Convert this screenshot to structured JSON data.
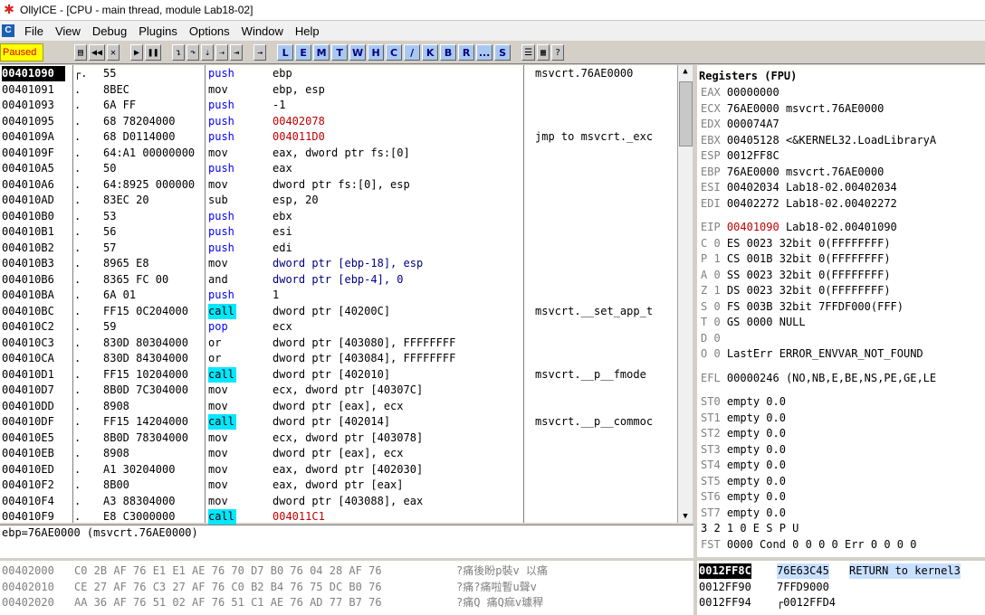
{
  "window": {
    "title": "OllyICE - [CPU - main thread, module Lab18-02]"
  },
  "menu": [
    "File",
    "View",
    "Debug",
    "Plugins",
    "Options",
    "Window",
    "Help"
  ],
  "toolbar": {
    "status": "Paused",
    "letters": [
      "L",
      "E",
      "M",
      "T",
      "W",
      "H",
      "C",
      "/",
      "K",
      "B",
      "R",
      "...",
      "S"
    ]
  },
  "disasm": {
    "rows": [
      {
        "addr": "00401090",
        "mark": "┌.",
        "hex": "55",
        "mn": "push",
        "op": "ebp",
        "cm": "msvcrt.76AE0000"
      },
      {
        "addr": "00401091",
        "mark": ".",
        "hex": "8BEC",
        "mn": "mov",
        "op": "ebp, esp",
        "cm": ""
      },
      {
        "addr": "00401093",
        "mark": ".",
        "hex": "6A FF",
        "mn": "push",
        "op": "-1",
        "cm": ""
      },
      {
        "addr": "00401095",
        "mark": ".",
        "hex": "68 78204000",
        "mn": "push",
        "op": "00402078",
        "cm": ""
      },
      {
        "addr": "0040109A",
        "mark": ".",
        "hex": "68 D0114000",
        "mn": "push",
        "op": "004011D0",
        "cm": "jmp to msvcrt._exc"
      },
      {
        "addr": "0040109F",
        "mark": ".",
        "hex": "64:A1 00000000",
        "mn": "mov",
        "op": "eax, dword ptr fs:[0]",
        "cm": ""
      },
      {
        "addr": "004010A5",
        "mark": ".",
        "hex": "50",
        "mn": "push",
        "op": "eax",
        "cm": ""
      },
      {
        "addr": "004010A6",
        "mark": ".",
        "hex": "64:8925 000000",
        "mn": "mov",
        "op": "dword ptr fs:[0], esp",
        "cm": ""
      },
      {
        "addr": "004010AD",
        "mark": ".",
        "hex": "83EC 20",
        "mn": "sub",
        "op": "esp, 20",
        "cm": ""
      },
      {
        "addr": "004010B0",
        "mark": ".",
        "hex": "53",
        "mn": "push",
        "op": "ebx",
        "cm": ""
      },
      {
        "addr": "004010B1",
        "mark": ".",
        "hex": "56",
        "mn": "push",
        "op": "esi",
        "cm": ""
      },
      {
        "addr": "004010B2",
        "mark": ".",
        "hex": "57",
        "mn": "push",
        "op": "edi",
        "cm": ""
      },
      {
        "addr": "004010B3",
        "mark": ".",
        "hex": "8965 E8",
        "mn": "mov",
        "op": "dword ptr [ebp-18], esp",
        "cm": ""
      },
      {
        "addr": "004010B6",
        "mark": ".",
        "hex": "8365 FC 00",
        "mn": "and",
        "op": "dword ptr [ebp-4], 0",
        "cm": ""
      },
      {
        "addr": "004010BA",
        "mark": ".",
        "hex": "6A 01",
        "mn": "push",
        "op": "1",
        "cm": ""
      },
      {
        "addr": "004010BC",
        "mark": ".",
        "hex": "FF15 0C204000",
        "mn": "call",
        "op": "dword ptr [40200C]",
        "cm": "msvcrt.__set_app_t"
      },
      {
        "addr": "004010C2",
        "mark": ".",
        "hex": "59",
        "mn": "pop",
        "op": "ecx",
        "cm": ""
      },
      {
        "addr": "004010C3",
        "mark": ".",
        "hex": "830D 80304000",
        "mn": "or",
        "op": "dword ptr [403080], FFFFFFFF",
        "cm": ""
      },
      {
        "addr": "004010CA",
        "mark": ".",
        "hex": "830D 84304000",
        "mn": "or",
        "op": "dword ptr [403084], FFFFFFFF",
        "cm": ""
      },
      {
        "addr": "004010D1",
        "mark": ".",
        "hex": "FF15 10204000",
        "mn": "call",
        "op": "dword ptr [402010]",
        "cm": "msvcrt.__p__fmode"
      },
      {
        "addr": "004010D7",
        "mark": ".",
        "hex": "8B0D 7C304000",
        "mn": "mov",
        "op": "ecx, dword ptr [40307C]",
        "cm": ""
      },
      {
        "addr": "004010DD",
        "mark": ".",
        "hex": "8908",
        "mn": "mov",
        "op": "dword ptr [eax], ecx",
        "cm": ""
      },
      {
        "addr": "004010DF",
        "mark": ".",
        "hex": "FF15 14204000",
        "mn": "call",
        "op": "dword ptr [402014]",
        "cm": "msvcrt.__p__commoc"
      },
      {
        "addr": "004010E5",
        "mark": ".",
        "hex": "8B0D 78304000",
        "mn": "mov",
        "op": "ecx, dword ptr [403078]",
        "cm": ""
      },
      {
        "addr": "004010EB",
        "mark": ".",
        "hex": "8908",
        "mn": "mov",
        "op": "dword ptr [eax], ecx",
        "cm": ""
      },
      {
        "addr": "004010ED",
        "mark": ".",
        "hex": "A1 30204000",
        "mn": "mov",
        "op": "eax, dword ptr [402030]",
        "cm": ""
      },
      {
        "addr": "004010F2",
        "mark": ".",
        "hex": "8B00",
        "mn": "mov",
        "op": "eax, dword ptr [eax]",
        "cm": ""
      },
      {
        "addr": "004010F4",
        "mark": ".",
        "hex": "A3 88304000",
        "mn": "mov",
        "op": "dword ptr [403088], eax",
        "cm": ""
      },
      {
        "addr": "004010F9",
        "mark": ".",
        "hex": "E8 C3000000",
        "mn": "call",
        "op": "004011C1",
        "cm": ""
      }
    ]
  },
  "info": {
    "line": "ebp=76AE0000 (msvcrt.76AE0000)"
  },
  "registers": {
    "header": "Registers (FPU)",
    "lines": [
      {
        "n": "EAX",
        "v": "00000000",
        "c": ""
      },
      {
        "n": "ECX",
        "v": "76AE0000",
        "c": "msvcrt.76AE0000"
      },
      {
        "n": "EDX",
        "v": "000074A7",
        "c": ""
      },
      {
        "n": "EBX",
        "v": "00405128",
        "c": "<&KERNEL32.LoadLibraryA"
      },
      {
        "n": "ESP",
        "v": "0012FF8C",
        "c": ""
      },
      {
        "n": "EBP",
        "v": "76AE0000",
        "c": "msvcrt.76AE0000"
      },
      {
        "n": "ESI",
        "v": "00402034",
        "c": "Lab18-02.00402034"
      },
      {
        "n": "EDI",
        "v": "00402272",
        "c": "Lab18-02.00402272"
      },
      {
        "n": "EIP",
        "v": "00401090",
        "c": "Lab18-02.00401090"
      },
      {
        "n": "C 0",
        "v": "ES 0023 32bit 0(FFFFFFFF)",
        "c": ""
      },
      {
        "n": "P 1",
        "v": "CS 001B 32bit 0(FFFFFFFF)",
        "c": ""
      },
      {
        "n": "A 0",
        "v": "SS 0023 32bit 0(FFFFFFFF)",
        "c": ""
      },
      {
        "n": "Z 1",
        "v": "DS 0023 32bit 0(FFFFFFFF)",
        "c": ""
      },
      {
        "n": "S 0",
        "v": "FS 003B 32bit 7FFDF000(FFF)",
        "c": ""
      },
      {
        "n": "T 0",
        "v": "GS 0000 NULL",
        "c": ""
      },
      {
        "n": "D 0",
        "v": "",
        "c": ""
      },
      {
        "n": "O 0",
        "v": "LastErr ERROR_ENVVAR_NOT_FOUND",
        "c": ""
      },
      {
        "n": "EFL",
        "v": "00000246",
        "c": "(NO,NB,E,BE,NS,PE,GE,LE"
      },
      {
        "n": "ST0",
        "v": "empty 0.0",
        "c": ""
      },
      {
        "n": "ST1",
        "v": "empty 0.0",
        "c": ""
      },
      {
        "n": "ST2",
        "v": "empty 0.0",
        "c": ""
      },
      {
        "n": "ST3",
        "v": "empty 0.0",
        "c": ""
      },
      {
        "n": "ST4",
        "v": "empty 0.0",
        "c": ""
      },
      {
        "n": "ST5",
        "v": "empty 0.0",
        "c": ""
      },
      {
        "n": "ST6",
        "v": "empty 0.0",
        "c": ""
      },
      {
        "n": "ST7",
        "v": "empty 0.0",
        "c": ""
      },
      {
        "n": "",
        "v": "3 2 1 0      E S P U",
        "c": ""
      },
      {
        "n": "FST",
        "v": "0000  Cond 0 0 0 0  Err 0 0 0 0",
        "c": ""
      }
    ]
  },
  "dump": {
    "rows": [
      {
        "addr": "00402000",
        "hex": "C0 2B AF 76 E1 E1 AE 76 70 D7 B0 76 04 28 AF 76",
        "txt": "?痛後盼p裝v 以痛"
      },
      {
        "addr": "00402010",
        "hex": "CE 27 AF 76 C3 27 AF 76 C0 B2 B4 76 75 DC B0 76",
        "txt": "?痛?痛啦暫u聲v"
      },
      {
        "addr": "00402020",
        "hex": "AA 36 AF 76 51 02 AF 76 51 C1 AE 76 AD 77 B7 76",
        "txt": "?痛Q 痛Q痲v璩稈"
      }
    ]
  },
  "stack": {
    "rows": [
      {
        "addr": "0012FF8C",
        "val": "76E63C45",
        "cm": "RETURN to kernel3"
      },
      {
        "addr": "0012FF90",
        "val": "7FFD9000",
        "cm": ""
      },
      {
        "addr": "0012FF94",
        "val": "┌0012FFD4",
        "cm": ""
      }
    ]
  }
}
